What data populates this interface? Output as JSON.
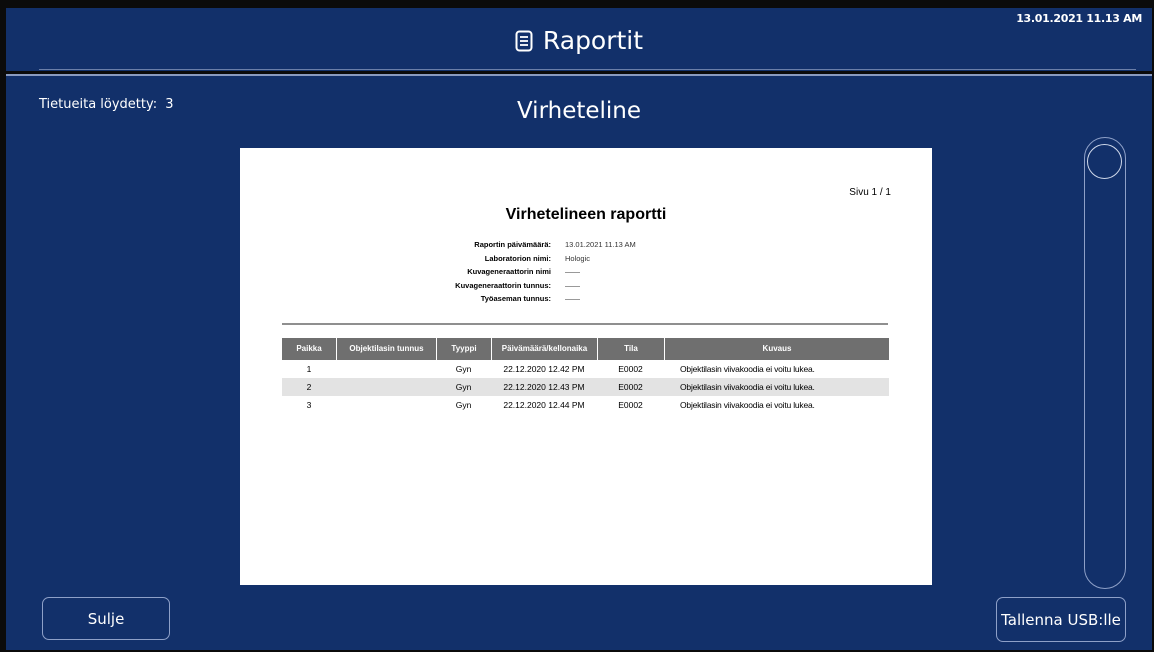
{
  "header": {
    "title": "Raportit",
    "clock": "13.01.2021 11.13 AM",
    "icon": "document-icon"
  },
  "main": {
    "records_label": "Tietueita löydetty:",
    "records_count": "3",
    "title": "Virheteline"
  },
  "report": {
    "page": "Sivu 1 / 1",
    "title": "Virhetelineen raportti",
    "meta": [
      {
        "label": "Raportin päivämäärä:",
        "value": "13.01.2021 11.13 AM"
      },
      {
        "label": "Laboratorion nimi:",
        "value": "Hologic"
      },
      {
        "label": "Kuvageneraattorin nimi",
        "value": "——"
      },
      {
        "label": "Kuvageneraattorin tunnus:",
        "value": "——"
      },
      {
        "label": "Työaseman tunnus:",
        "value": "——"
      }
    ],
    "columns": [
      "Paikka",
      "Objektilasin tunnus",
      "Tyyppi",
      "Päivämäärä/kellonaika",
      "Tila",
      "Kuvaus"
    ],
    "rows": [
      {
        "paikka": "1",
        "tunnus": "",
        "tyyppi": "Gyn",
        "aika": "22.12.2020 12.42 PM",
        "tila": "E0002",
        "kuvaus": "Objektilasin viivakoodia ei voitu lukea."
      },
      {
        "paikka": "2",
        "tunnus": "",
        "tyyppi": "Gyn",
        "aika": "22.12.2020 12.43 PM",
        "tila": "E0002",
        "kuvaus": "Objektilasin viivakoodia ei voitu lukea."
      },
      {
        "paikka": "3",
        "tunnus": "",
        "tyyppi": "Gyn",
        "aika": "22.12.2020 12.44 PM",
        "tila": "E0002",
        "kuvaus": "Objektilasin viivakoodia ei voitu lukea."
      }
    ]
  },
  "buttons": {
    "close": "Sulje",
    "save_usb": "Tallenna USB:lle"
  },
  "colors": {
    "background": "#12306a",
    "frame": "#0b0b0b",
    "table_header": "#6f6f6f",
    "alt_row": "#e3e3e3",
    "border": "#8ea0c8"
  }
}
